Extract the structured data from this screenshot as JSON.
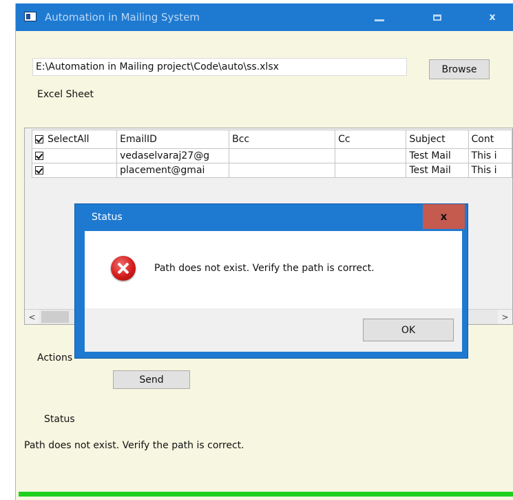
{
  "window": {
    "title": "Automation in Mailing System",
    "minimize_icon": "minimize-icon",
    "maximize_icon": "maximize-icon",
    "close_label": "x"
  },
  "file": {
    "path": "E:\\Automation in Mailing project\\Code\\auto\\ss.xlsx",
    "browse_label": "Browse",
    "sheet_label": "Excel Sheet"
  },
  "grid": {
    "select_all_label": "SelectAll",
    "columns": [
      "EmailID",
      "Bcc",
      "Cc",
      "Subject",
      "Cont"
    ],
    "rows": [
      {
        "checked": true,
        "email": "vedaselvaraj27@g",
        "bcc": "",
        "cc": "",
        "subject": "Test Mail",
        "content": "This i"
      },
      {
        "checked": true,
        "email": "placement@gmai",
        "bcc": "",
        "cc": "",
        "subject": "Test Mail",
        "content": "This i"
      }
    ],
    "scroll_left": "<",
    "scroll_right": ">"
  },
  "actions": {
    "label": "Actions",
    "send_label": "Send"
  },
  "status": {
    "label": "Status",
    "message": "Path does not exist. Verify the path is correct.",
    "progress": 1.0,
    "progress_color": "#1fd11f"
  },
  "dialog": {
    "title": "Status",
    "close_label": "x",
    "icon": "error-icon",
    "message": "Path does not exist. Verify the path is correct.",
    "ok_label": "OK"
  },
  "colors": {
    "titlebar": "#1e7ad1",
    "window_bg": "#f7f7e1",
    "dialog_close": "#c55a4f"
  }
}
